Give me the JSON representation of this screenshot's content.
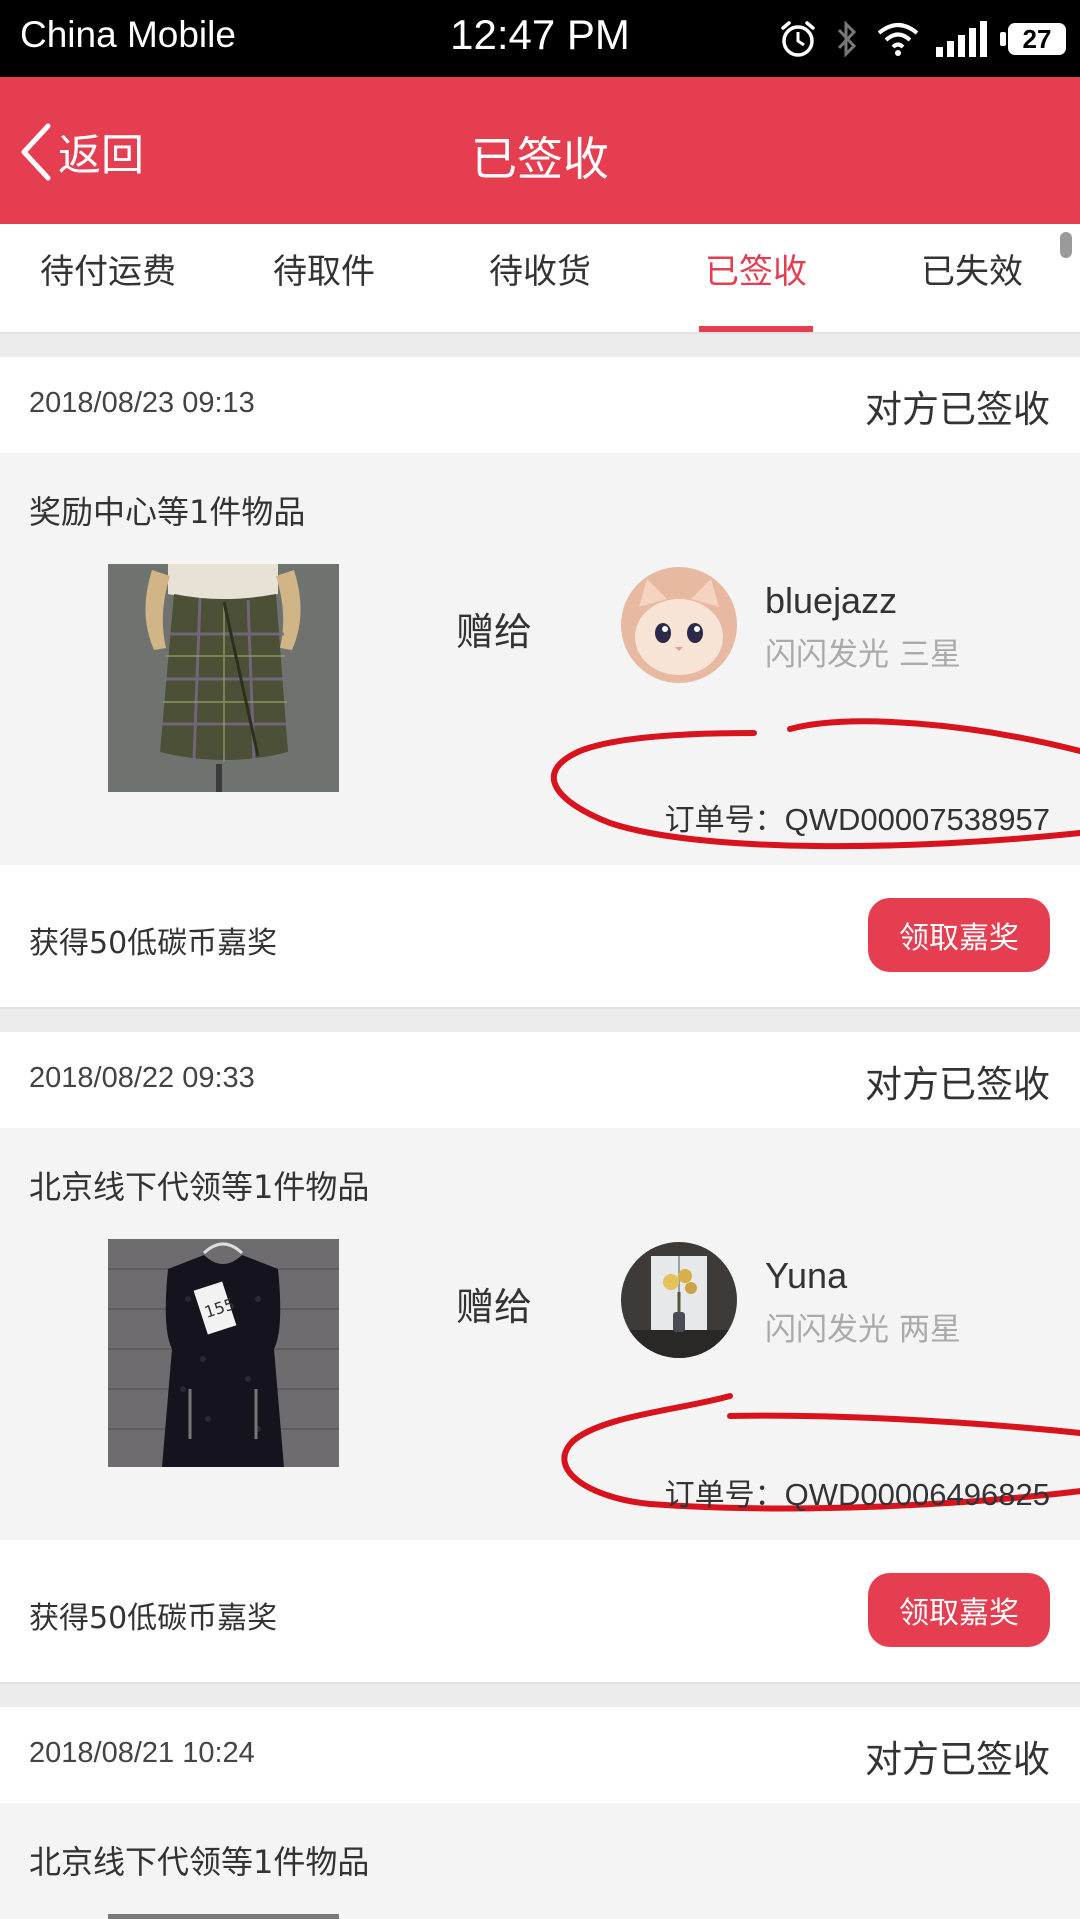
{
  "status_bar": {
    "carrier": "China Mobile",
    "time": "12:47 PM",
    "battery": "27"
  },
  "header": {
    "back_label": "返回",
    "title": "已签收"
  },
  "tabs": [
    {
      "label": "待付运费",
      "active": false
    },
    {
      "label": "待取件",
      "active": false
    },
    {
      "label": "待收货",
      "active": false
    },
    {
      "label": "已签收",
      "active": true
    },
    {
      "label": "已失效",
      "active": false
    }
  ],
  "orders": [
    {
      "date": "2018/08/23 09:13",
      "status": "对方已签收",
      "item_title": "奖励中心等1件物品",
      "gift_label": "赠给",
      "user_name": "bluejazz",
      "user_level": "闪闪发光 三星",
      "order_label": "订单号：",
      "order_number": "QWD00007538957",
      "reward_text": "获得50低碳币嘉奖",
      "claim_label": "领取嘉奖",
      "photo_icon": "plaid-skirt-photo",
      "avatar_icon": "cat-avatar"
    },
    {
      "date": "2018/08/22 09:33",
      "status": "对方已签收",
      "item_title": "北京线下代领等1件物品",
      "gift_label": "赠给",
      "user_name": "Yuna",
      "user_level": "闪闪发光 两星",
      "order_label": "订单号：",
      "order_number": "QWD00006496825",
      "reward_text": "获得50低碳币嘉奖",
      "claim_label": "领取嘉奖",
      "photo_icon": "sequin-dress-photo",
      "avatar_icon": "flower-vase-avatar"
    },
    {
      "date": "2018/08/21 10:24",
      "status": "对方已签收",
      "item_title": "北京线下代领等1件物品"
    }
  ],
  "colors": {
    "accent": "#e63e51",
    "annotation": "#d8131d"
  }
}
